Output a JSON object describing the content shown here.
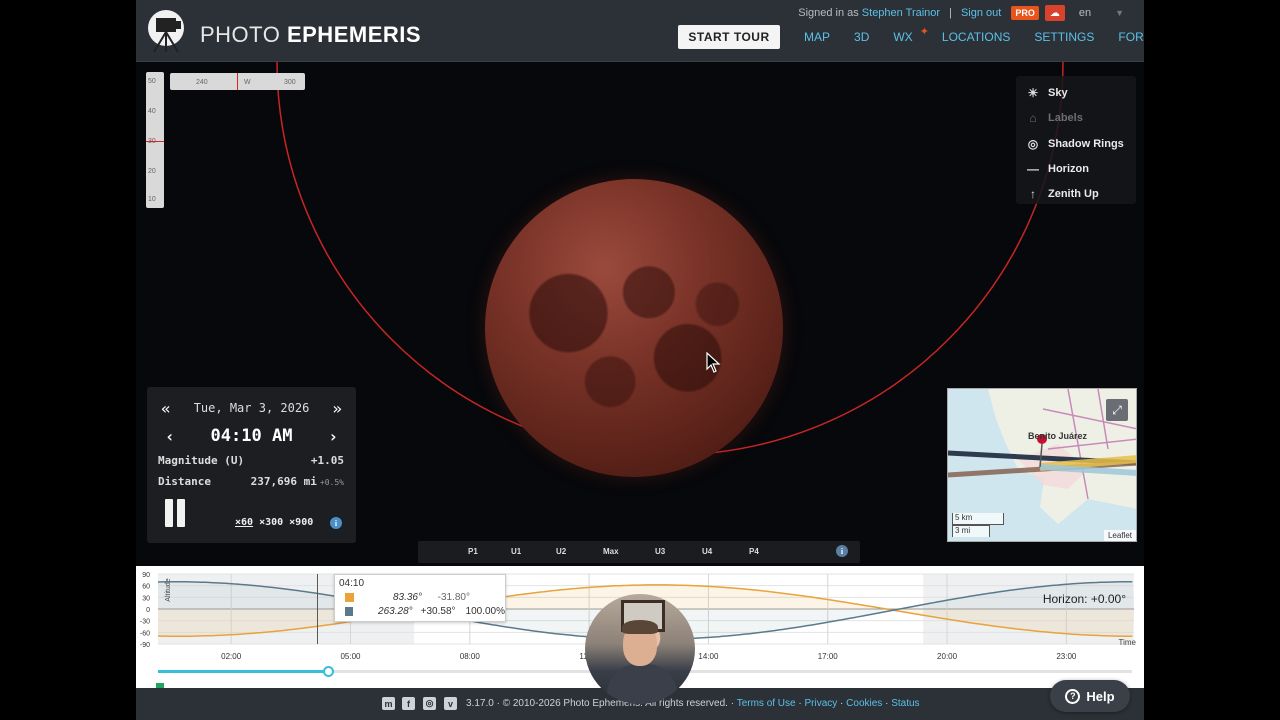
{
  "header": {
    "logo_text_light": "PHOTO",
    "logo_text_bold": "EPHEMERIS",
    "signed_in_prefix": "Signed in as",
    "user_name": "Stephen Trainor",
    "separator": "|",
    "sign_out": "Sign out",
    "pro_badge": "PRO",
    "language": "en",
    "start_tour": "START TOUR",
    "nav": [
      "MAP",
      "3D",
      "WX",
      "LOCATIONS",
      "SETTINGS",
      "FORUM"
    ],
    "wx_star": "✦"
  },
  "sky": {
    "altitude_ticks": [
      "50",
      "40",
      "30",
      "20",
      "10"
    ],
    "azimuth_ticks": [
      "240",
      "W",
      "300"
    ]
  },
  "layers": [
    {
      "label": "Sky",
      "icon": "sun-icon",
      "enabled": true
    },
    {
      "label": "Labels",
      "icon": "tag-icon",
      "enabled": false
    },
    {
      "label": "Shadow Rings",
      "icon": "target-icon",
      "enabled": true
    },
    {
      "label": "Horizon",
      "icon": "horizon-line-icon",
      "enabled": true
    },
    {
      "label": "Zenith Up",
      "icon": "arrow-up-icon",
      "enabled": true
    }
  ],
  "info_panel": {
    "date": "Tue, Mar 3, 2026",
    "time": "04:10 AM",
    "magnitude_label": "Magnitude (U)",
    "magnitude_value": "+1.05",
    "distance_label": "Distance",
    "distance_value": "237,696 mi",
    "distance_change": "+0.5%",
    "speeds": [
      "×60",
      "×300",
      "×900"
    ],
    "selected_speed": "×60",
    "info_symbol": "i"
  },
  "contacts": [
    "P1",
    "U1",
    "U2",
    "Max",
    "U3",
    "U4",
    "P4"
  ],
  "minimap": {
    "place": "Benito Juárez",
    "scale_km": "5 km",
    "scale_mi": "3 mi",
    "attribution": "Leaflet"
  },
  "altitude_chart": {
    "y_ticks": [
      "90",
      "60",
      "30",
      "0",
      "-30",
      "-60",
      "-90"
    ],
    "y_label": "Altitude",
    "x_ticks": [
      "02:00",
      "05:00",
      "08:00",
      "11:00",
      "14:00",
      "17:00",
      "20:00",
      "23:00"
    ],
    "x_label": "Time",
    "horizon_label": "Horizon: +0.00°",
    "tooltip": {
      "time": "04:10",
      "sun_az": "83.36°",
      "sun_alt": "-31.80°",
      "moon_az": "263.28°",
      "moon_alt": "+30.58°",
      "moon_illum": "100.00%"
    },
    "colors": {
      "sun": "#e8a33a",
      "moon": "#5a7a8c"
    }
  },
  "footer": {
    "version": "3.17.0 · © 2010-2026 Photo Ephemeris. All rights reserved.",
    "links": [
      "Terms of Use",
      "Privacy",
      "Cookies",
      "Status"
    ],
    "social": [
      "mastodon-icon",
      "facebook-icon",
      "instagram-icon",
      "vimeo-icon"
    ]
  },
  "help_label": "Help",
  "colors": {
    "accent": "#5cc0e6",
    "shadow_ring": "#d22a2a",
    "header_bg": "#2c3138"
  }
}
